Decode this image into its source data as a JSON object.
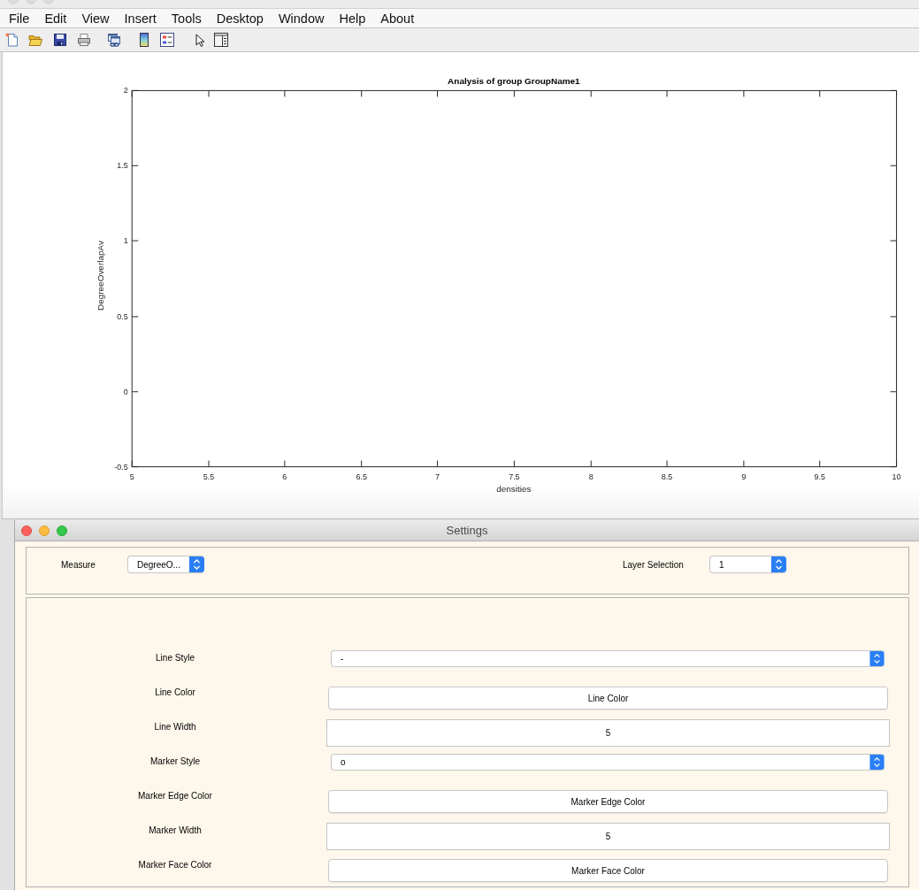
{
  "figure_window": {
    "menu": [
      "File",
      "Edit",
      "View",
      "Insert",
      "Tools",
      "Desktop",
      "Window",
      "Help",
      "About"
    ],
    "chart_data": {
      "type": "line",
      "title": "Analysis of group GroupName1",
      "xlabel": "densities",
      "ylabel": "DegreeOverlapAv",
      "xlim": [
        5,
        10
      ],
      "ylim": [
        -0.5,
        2
      ],
      "xticks": [
        5,
        5.5,
        6,
        6.5,
        7,
        7.5,
        8,
        8.5,
        9,
        9.5,
        10
      ],
      "yticks": [
        -0.5,
        0,
        0.5,
        1,
        1.5,
        2
      ]
    }
  },
  "settings_window": {
    "title": "Settings",
    "top_panel": [
      {
        "label": "Measure",
        "value": "DegreeO..."
      },
      {
        "label": "Layer Selection",
        "value": "1"
      }
    ],
    "properties": [
      {
        "kind": "popup",
        "label": "Line Style",
        "value": "-"
      },
      {
        "kind": "button",
        "label": "Line Color",
        "text": "Line Color"
      },
      {
        "kind": "field",
        "label": "Line Width",
        "value": "5"
      },
      {
        "kind": "popup",
        "label": "Marker Style",
        "value": "o"
      },
      {
        "kind": "button",
        "label": "Marker Edge Color",
        "text": "Marker Edge Color"
      },
      {
        "kind": "field",
        "label": "Marker Width",
        "value": "5"
      },
      {
        "kind": "button",
        "label": "Marker Face Color",
        "text": "Marker Face Color"
      }
    ]
  }
}
